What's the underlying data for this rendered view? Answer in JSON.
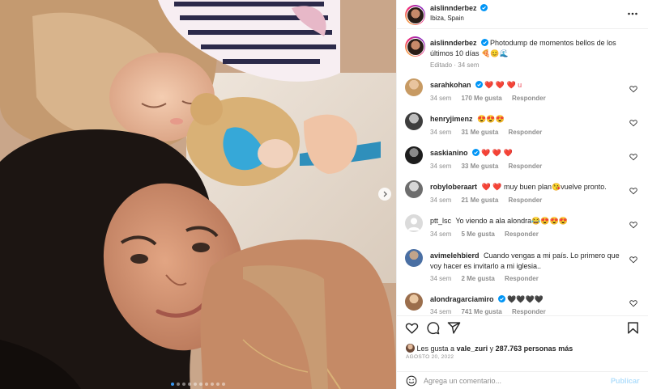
{
  "post": {
    "author": "aislinnderbez",
    "location": "Ibiza, Spain",
    "caption": "Photodump de momentos bellos de los últimos 10 días 🍕😊🌊",
    "caption_meta": "Editado · 34 sem",
    "image_alt": "selfie",
    "carousel_count": 10,
    "carousel_active": 1
  },
  "comments": [
    {
      "user": "sarahkohan",
      "text": "❤️ ❤️ ❤️ u",
      "time": "34 sem",
      "likes": "170 Me gusta",
      "reply": "Responder",
      "verified": true
    },
    {
      "user": "henryjimenz",
      "text": "😍😍😍",
      "time": "34 sem",
      "likes": "31 Me gusta",
      "reply": "Responder",
      "verified": false
    },
    {
      "user": "saskianino",
      "text": "❤️ ❤️ ❤️",
      "time": "34 sem",
      "likes": "33 Me gusta",
      "reply": "Responder",
      "verified": true
    },
    {
      "user": "robyloberaart",
      "text": "❤️ ❤️ muy buen plan😘vuelve pronto.",
      "time": "34 sem",
      "likes": "21 Me gusta",
      "reply": "Responder",
      "verified": false
    },
    {
      "user": "ptt_lsc",
      "text": "Yo viendo a ala alondra😂😍😍😍",
      "time": "34 sem",
      "likes": "5 Me gusta",
      "reply": "Responder",
      "verified": false
    },
    {
      "user": "avimelehbierd",
      "text": "Cuando vengas a mi país. Lo primero que voy hacer es invitarlo a mi iglesia..",
      "time": "34 sem",
      "likes": "2 Me gusta",
      "reply": "Responder",
      "verified": false
    },
    {
      "user": "alondragarciamiro",
      "text": "🖤🖤🖤🖤",
      "time": "34 sem",
      "likes": "741 Me gusta",
      "reply": "Responder",
      "verified": true
    }
  ],
  "engagement": {
    "likes_prefix": "Les gusta a",
    "likes_user": "vale_zuri",
    "likes_middle": "y",
    "likes_count": "287.763 personas más",
    "date": "AGOSTO 20, 2022"
  },
  "composer": {
    "placeholder": "Agrega un comentario...",
    "publish_label": "Publicar"
  },
  "colors": {
    "verified": "#0095f6",
    "text": "#262626",
    "muted": "#8e8e8e",
    "publish_disabled": "#b2dffc",
    "heart": "#ed4956"
  },
  "icons": [
    "verified-badge-icon",
    "more-options-icon",
    "heart-icon",
    "comment-icon",
    "share-icon",
    "bookmark-icon",
    "emoji-icon",
    "chevron-right-icon"
  ]
}
